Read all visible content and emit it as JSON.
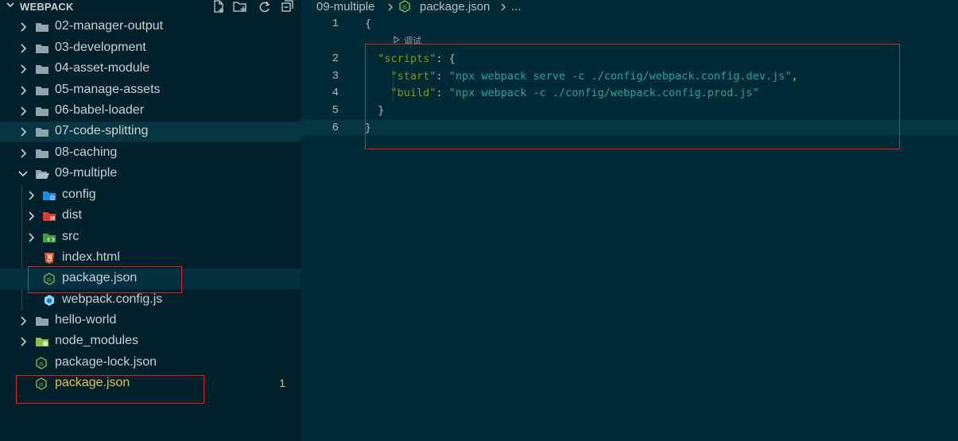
{
  "sidebar": {
    "title": "WEBPACK",
    "actions": [
      {
        "name": "new-file-icon"
      },
      {
        "name": "new-folder-icon"
      },
      {
        "name": "refresh-icon"
      },
      {
        "name": "collapse-all-icon"
      }
    ],
    "items": [
      {
        "label": "02-manager-output",
        "icon": "folder-icon"
      },
      {
        "label": "03-development",
        "icon": "folder-icon"
      },
      {
        "label": "04-asset-module",
        "icon": "folder-icon"
      },
      {
        "label": "05-manage-assets",
        "icon": "folder-icon"
      },
      {
        "label": "06-babel-loader",
        "icon": "folder-icon"
      },
      {
        "label": "07-code-splitting",
        "icon": "folder-icon"
      },
      {
        "label": "08-caching",
        "icon": "folder-icon"
      },
      {
        "label": "09-multiple",
        "icon": "folder-open-icon"
      },
      {
        "label": "config",
        "icon": "config-folder-icon"
      },
      {
        "label": "dist",
        "icon": "dist-folder-icon"
      },
      {
        "label": "src",
        "icon": "src-folder-icon"
      },
      {
        "label": "index.html",
        "icon": "html5-icon"
      },
      {
        "label": "package.json",
        "icon": "nodejs-icon"
      },
      {
        "label": "webpack.config.js",
        "icon": "webpack-icon"
      },
      {
        "label": "hello-world",
        "icon": "folder-icon"
      },
      {
        "label": "node_modules",
        "icon": "node-modules-folder-icon"
      },
      {
        "label": "package-lock.json",
        "icon": "nodejs-icon"
      },
      {
        "label": "package.json",
        "icon": "nodejs-icon",
        "badge": "1"
      }
    ]
  },
  "editor": {
    "breadcrumb": {
      "folder": "09-multiple",
      "file": "package.json",
      "more": "..."
    },
    "codelens": "调试",
    "line_numbers": [
      "1",
      "2",
      "3",
      "4",
      "5",
      "6"
    ],
    "code": {
      "l1_open": "{",
      "l2_key": "\"scripts\"",
      "l2_rest": ": {",
      "l3_key": "\"start\"",
      "l3_colon": ": ",
      "l3_val": "\"npx webpack serve -c ./config/webpack.config.dev.js\"",
      "l3_comma": ",",
      "l4_key": "\"build\"",
      "l4_colon": ": ",
      "l4_val": "\"npx webpack -c ./config/webpack.config.prod.js\"",
      "l5_close": "}",
      "l6_close": "}"
    }
  },
  "colors": {
    "editor_bg": "#002b36",
    "sidebar_bg": "#00212b",
    "key": "#859900",
    "string": "#2aa198",
    "modified": "#dac44d",
    "annotation_box": "#e02020"
  }
}
